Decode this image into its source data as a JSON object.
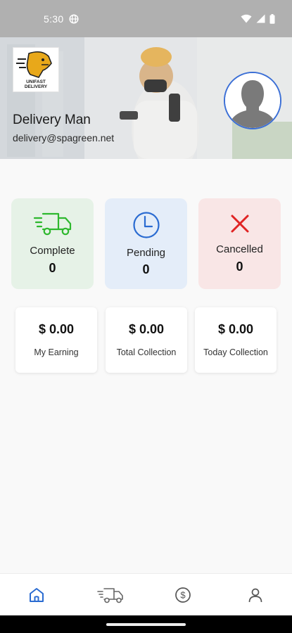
{
  "status_bar": {
    "time": "5:30",
    "icons": [
      "globe-icon",
      "wifi-icon",
      "signal-icon",
      "battery-icon"
    ]
  },
  "header": {
    "logo_text_line1": "UNIFAST",
    "logo_text_line2": "DELIVERY",
    "name": "Delivery Man",
    "email": "delivery@spagreen.net"
  },
  "status_cards": [
    {
      "label": "Complete",
      "count": "0",
      "icon": "delivery-truck-icon",
      "color": "#2eb82e"
    },
    {
      "label": "Pending",
      "count": "0",
      "icon": "clock-icon",
      "color": "#2a6bd1"
    },
    {
      "label": "Cancelled",
      "count": "0",
      "icon": "close-icon",
      "color": "#e02424"
    }
  ],
  "money_cards": [
    {
      "amount": "$ 0.00",
      "label": "My Earning"
    },
    {
      "amount": "$ 0.00",
      "label": "Total Collection"
    },
    {
      "amount": "$ 0.00",
      "label": "Today Collection"
    }
  ],
  "bottom_nav": [
    {
      "name": "home",
      "icon": "home-icon",
      "active": true
    },
    {
      "name": "parcels",
      "icon": "delivery-truck-icon",
      "active": false
    },
    {
      "name": "payments",
      "icon": "dollar-icon",
      "active": false
    },
    {
      "name": "profile",
      "icon": "user-icon",
      "active": false
    }
  ],
  "colors": {
    "accent": "#2a6bd1",
    "complete_bg": "#e6f2e7",
    "pending_bg": "#e4edf9",
    "cancelled_bg": "#f9e6e6",
    "status_bar": "#b0b0b0"
  }
}
